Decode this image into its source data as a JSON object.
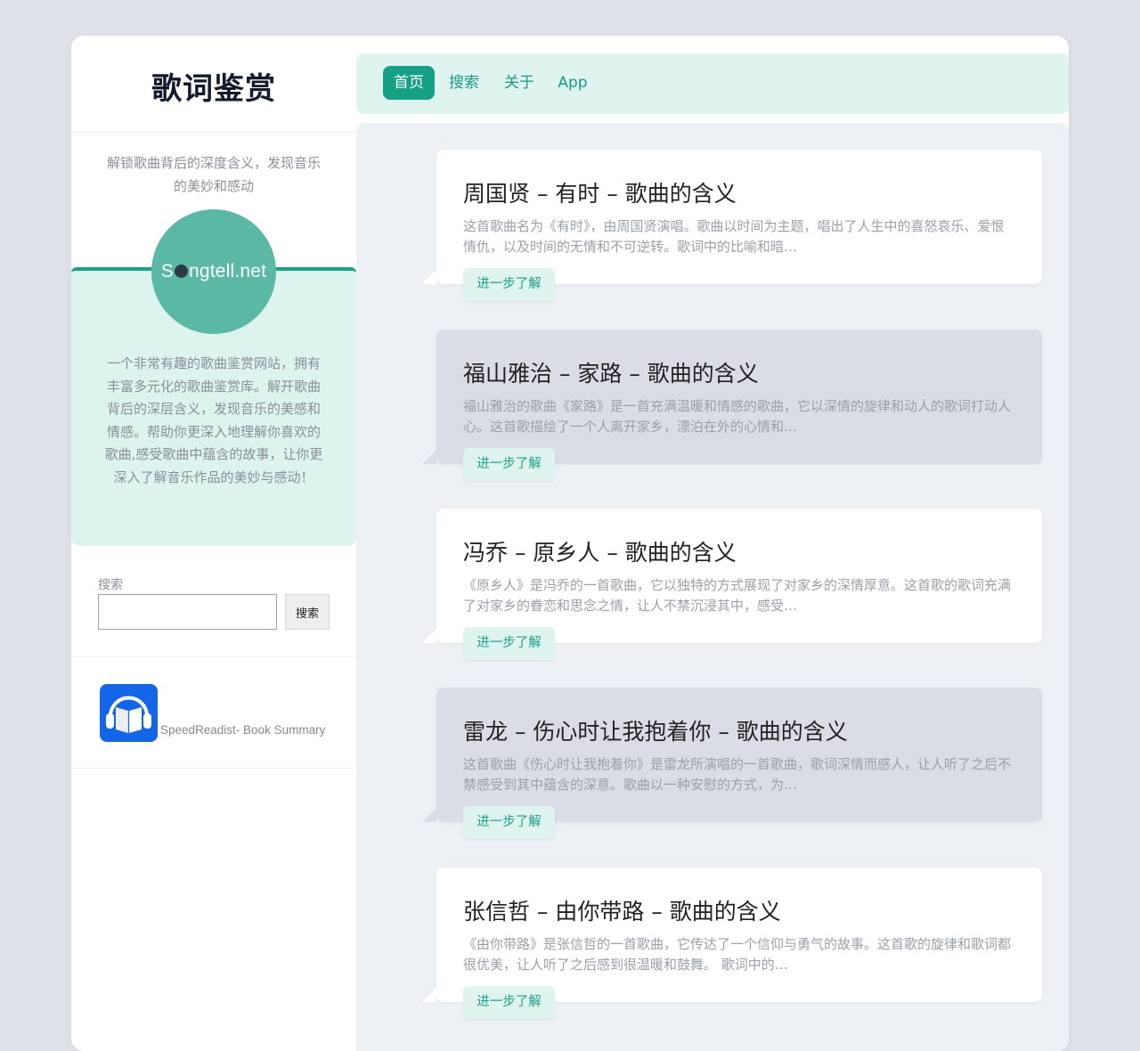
{
  "site": {
    "title": "歌词鉴赏",
    "tagline": "解锁歌曲背后的深度含义，发现音乐的美妙和感动",
    "logo_text_before": "S",
    "logo_text_after": "ngtell.net",
    "about": "一个非常有趣的歌曲鉴赏网站，拥有丰富多元化的歌曲鉴赏库。解开歌曲背后的深层含义，发现音乐的美感和情感。帮助你更深入地理解你喜欢的歌曲,感受歌曲中蕴含的故事，让你更深入了解音乐作品的美妙与感动！",
    "accent_color": "#16a085"
  },
  "search": {
    "label": "搜索",
    "button": "搜索",
    "value": ""
  },
  "app": {
    "label": "SpeedReadist- Book Summary",
    "icon": "headphones-book-icon"
  },
  "nav": {
    "items": [
      {
        "label": "首页",
        "active": true
      },
      {
        "label": "搜索",
        "active": false
      },
      {
        "label": "关于",
        "active": false
      },
      {
        "label": "App",
        "active": false
      }
    ]
  },
  "posts": [
    {
      "title": "周国贤 – 有时 – 歌曲的含义",
      "excerpt": "这首歌曲名为《有时》，由周国贤演唱。歌曲以时间为主题，唱出了人生中的喜怒哀乐、爱恨情仇，以及时间的无情和不可逆转。歌词中的比喻和暗…",
      "button": "进一步了解"
    },
    {
      "title": "福山雅治 – 家路 – 歌曲的含义",
      "excerpt": "福山雅治的歌曲《家路》是一首充满温暖和情感的歌曲，它以深情的旋律和动人的歌词打动人心。这首歌描绘了一个人离开家乡，漂泊在外的心情和…",
      "button": "进一步了解"
    },
    {
      "title": "冯乔 – 原乡人 – 歌曲的含义",
      "excerpt": "《原乡人》是冯乔的一首歌曲，它以独特的方式展现了对家乡的深情厚意。这首歌的歌词充满了对家乡的眷恋和思念之情，让人不禁沉浸其中，感受…",
      "button": "进一步了解"
    },
    {
      "title": "雷龙 – 伤心时让我抱着你 – 歌曲的含义",
      "excerpt": "这首歌曲《伤心时让我抱着你》是雷龙所演唱的一首歌曲，歌词深情而感人，让人听了之后不禁感受到其中蕴含的深意。歌曲以一种安慰的方式，为…",
      "button": "进一步了解"
    },
    {
      "title": "张信哲 – 由你带路 – 歌曲的含义",
      "excerpt": "《由你带路》是张信哲的一首歌曲，它传达了一个信仰与勇气的故事。这首歌的旋律和歌词都很优美，让人听了之后感到很温暖和鼓舞。 歌词中的…",
      "button": "进一步了解"
    }
  ]
}
